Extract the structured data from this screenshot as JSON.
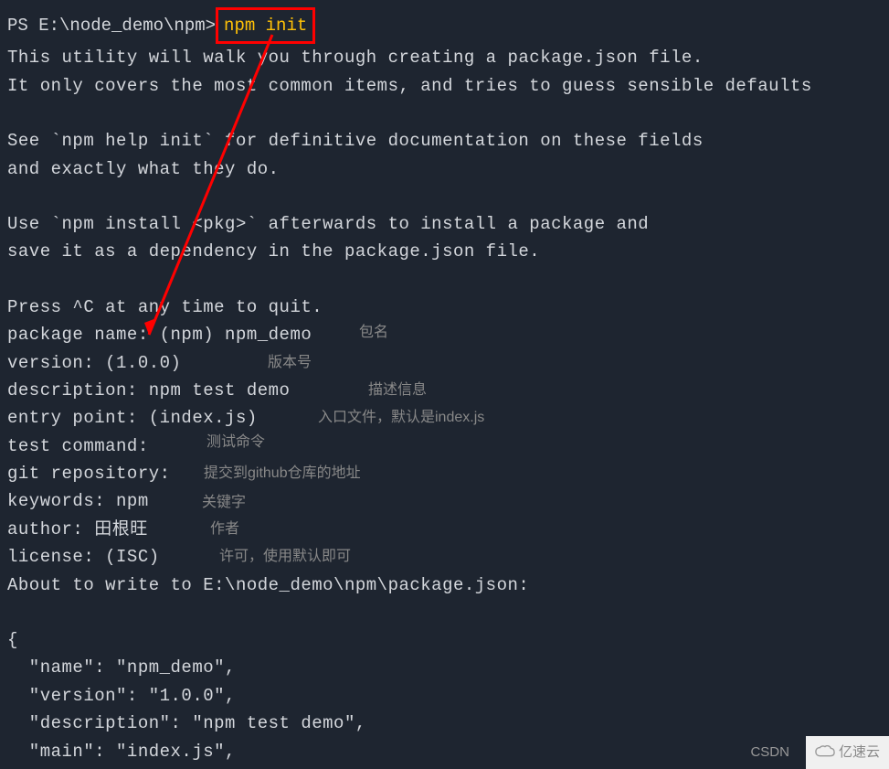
{
  "terminal": {
    "prompt": "PS E:\\node_demo\\npm> ",
    "command": "npm init",
    "intro_line1": "This utility will walk you through creating a package.json file.",
    "intro_line2": "It only covers the most common items, and tries to guess sensible defaults",
    "help_line1": "See `npm help init` for definitive documentation on these fields",
    "help_line2": "and exactly what they do.",
    "install_line1": "Use `npm install <pkg>` afterwards to install a package and",
    "install_line2": "save it as a dependency in the package.json file.",
    "quit_line": "Press ^C at any time to quit.",
    "prompts": {
      "package_name": "package name: (npm) npm_demo",
      "version": "version: (1.0.0)",
      "description": "description: npm test demo",
      "entry_point": "entry point: (index.js)",
      "test_command": "test command:",
      "git_repository": "git repository:",
      "keywords": "keywords: npm",
      "author": "author: 田根旺",
      "license": "license: (ISC)"
    },
    "about_to_write": "About to write to E:\\node_demo\\npm\\package.json:",
    "json_output": {
      "open_brace": "{",
      "name": "  \"name\": \"npm_demo\",",
      "version": "  \"version\": \"1.0.0\",",
      "description": "  \"description\": \"npm test demo\",",
      "main": "  \"main\": \"index.js\","
    }
  },
  "annotations": {
    "package_name": "包名",
    "version": "版本号",
    "description": "描述信息",
    "entry_point": "入口文件，默认是index.js",
    "test_command": "测试命令",
    "git_repository": "提交到github仓库的地址",
    "keywords": "关键字",
    "author": "作者",
    "license": "许可，使用默认即可"
  },
  "watermark": {
    "csdn": "CSDN",
    "brand": "亿速云"
  }
}
